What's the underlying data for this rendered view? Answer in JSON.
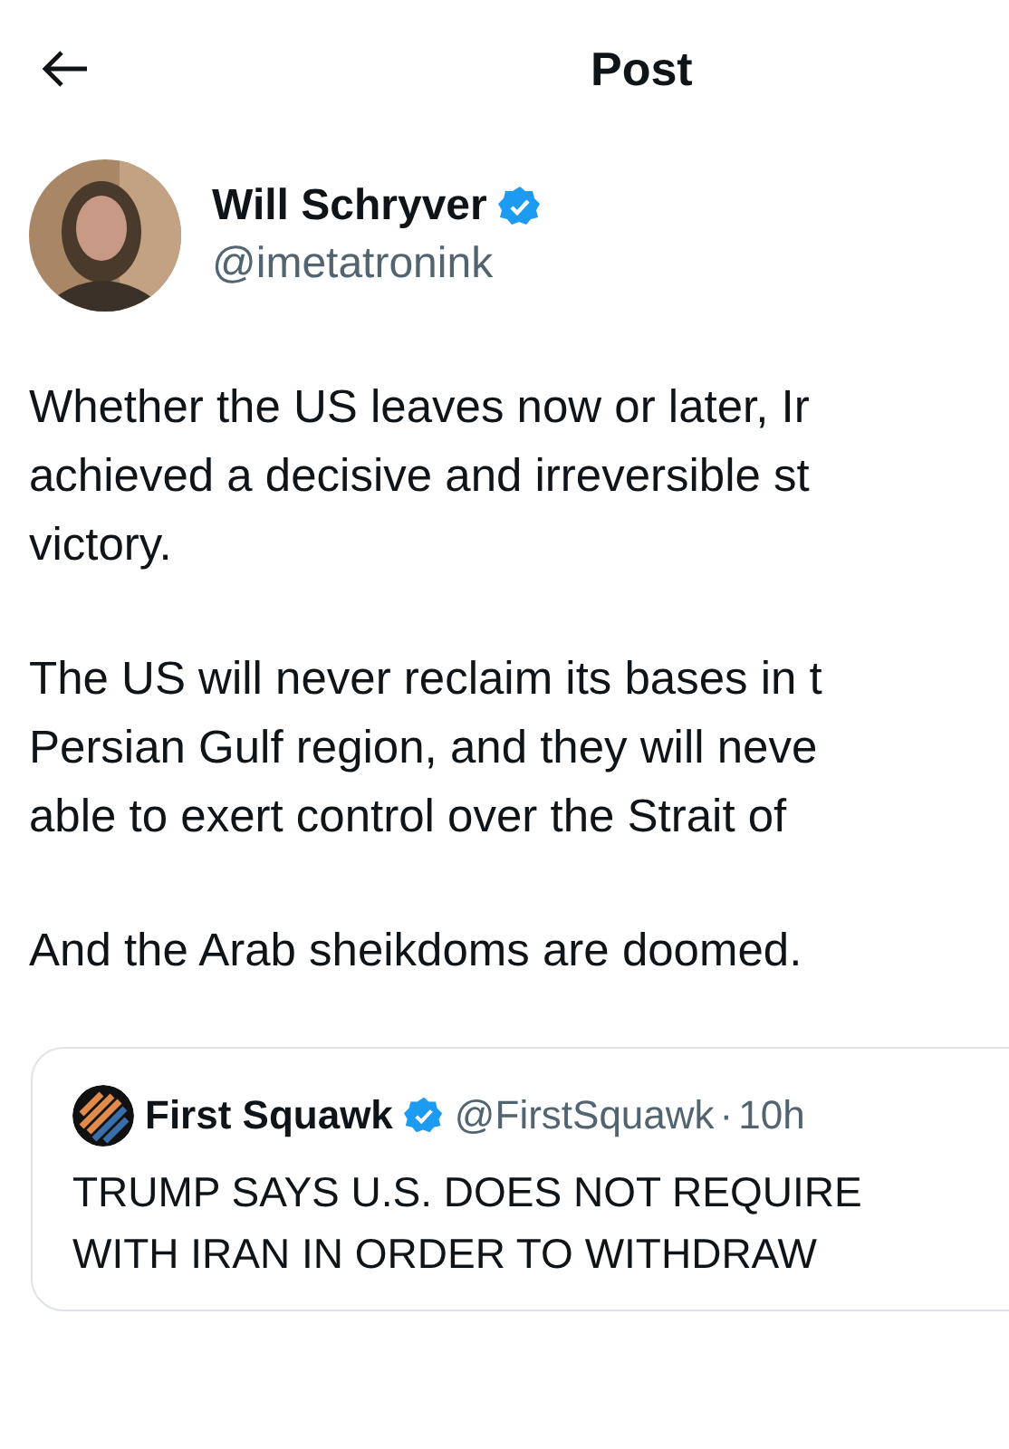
{
  "header": {
    "title": "Post"
  },
  "author": {
    "name": "Will Schryver",
    "verified": true,
    "handle": "@imetatronink"
  },
  "paragraphs": [
    [
      "Whether the US leaves now or later, Ir",
      "achieved a decisive and irreversible st",
      "victory."
    ],
    [
      "The US will never reclaim its bases in t",
      "Persian Gulf region, and they will neve",
      "able to exert control over the Strait of"
    ],
    [
      "And the Arab sheikdoms are doomed."
    ]
  ],
  "quote": {
    "name": "First Squawk",
    "verified": true,
    "handle": "@FirstSquawk",
    "separator": "·",
    "time": "10h",
    "lines": [
      "TRUMP SAYS U.S. DOES NOT REQUIRE",
      "WITH IRAN IN ORDER TO WITHDRAW"
    ]
  }
}
